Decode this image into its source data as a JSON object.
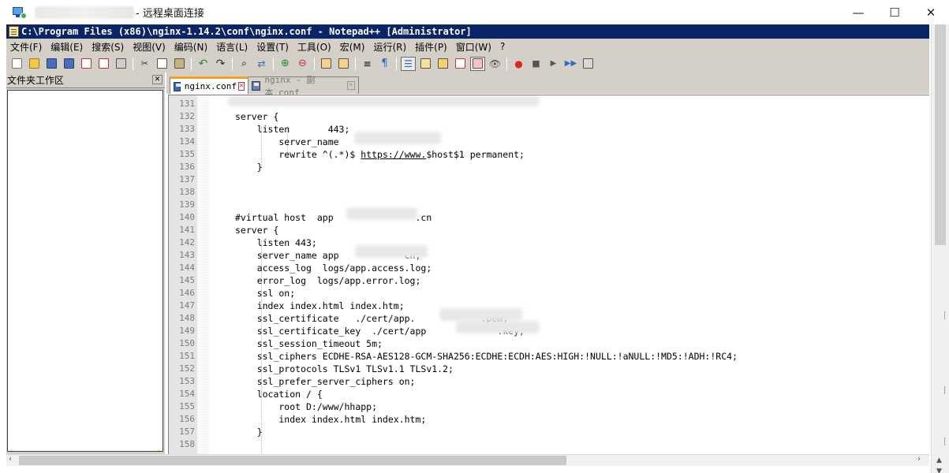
{
  "rdp": {
    "title": "- 远程桌面连接",
    "minimize": "—",
    "maximize": "☐",
    "close": "✕"
  },
  "npp": {
    "title": "C:\\Program Files (x86)\\nginx-1.14.2\\conf\\nginx.conf - Notepad++ [Administrator]"
  },
  "menu": [
    "文件(F)",
    "编辑(E)",
    "搜索(S)",
    "视图(V)",
    "编码(N)",
    "语言(L)",
    "设置(T)",
    "工具(O)",
    "宏(M)",
    "运行(R)",
    "插件(P)",
    "窗口(W)",
    "?"
  ],
  "folder_panel": {
    "title": "文件夹工作区",
    "close": "✕"
  },
  "tabs": [
    {
      "label": "nginx.conf",
      "close": "✕"
    },
    {
      "label": "nginx - 副本.conf",
      "close": "✕"
    }
  ],
  "editor": {
    "lines": [
      {
        "n": "131",
        "text": ""
      },
      {
        "n": "132",
        "text": "server {"
      },
      {
        "n": "133",
        "text": "    listen       443;"
      },
      {
        "n": "134",
        "text": "        server_name"
      },
      {
        "n": "135",
        "text": "        rewrite ^(.*)$ https://www.$host$1 permanent;"
      },
      {
        "n": "136",
        "text": "    }"
      },
      {
        "n": "137",
        "text": ""
      },
      {
        "n": "138",
        "text": ""
      },
      {
        "n": "139",
        "text": ""
      },
      {
        "n": "140",
        "text": "#virtual host  app               .cn"
      },
      {
        "n": "141",
        "text": "server {"
      },
      {
        "n": "142",
        "text": "    listen 443;"
      },
      {
        "n": "143",
        "text": "    server_name app            cn;"
      },
      {
        "n": "144",
        "text": "    access_log  logs/app.access.log;"
      },
      {
        "n": "145",
        "text": "    error_log  logs/app.error.log;"
      },
      {
        "n": "146",
        "text": "    ssl on;"
      },
      {
        "n": "147",
        "text": "    index index.html index.htm;"
      },
      {
        "n": "148",
        "text": "    ssl_certificate   ./cert/app.            .pem;"
      },
      {
        "n": "149",
        "text": "    ssl_certificate_key  ./cert/app             .key;"
      },
      {
        "n": "150",
        "text": "    ssl_session_timeout 5m;"
      },
      {
        "n": "151",
        "text": "    ssl_ciphers ECDHE-RSA-AES128-GCM-SHA256:ECDHE:ECDH:AES:HIGH:!NULL:!aNULL:!MD5:!ADH:!RC4;"
      },
      {
        "n": "152",
        "text": "    ssl_protocols TLSv1 TLSv1.1 TLSv1.2;"
      },
      {
        "n": "153",
        "text": "    ssl_prefer_server_ciphers on;"
      },
      {
        "n": "154",
        "text": "    location / {"
      },
      {
        "n": "155",
        "text": "        root D:/www/hhapp;"
      },
      {
        "n": "156",
        "text": "        index index.html index.htm;"
      },
      {
        "n": "157",
        "text": "    }"
      },
      {
        "n": "158",
        "text": ""
      }
    ]
  },
  "colors": {
    "npp_title_bg": "#0a246a",
    "chrome_bg": "#d4d0c8",
    "active_tab_accent": "#fa9b22"
  }
}
